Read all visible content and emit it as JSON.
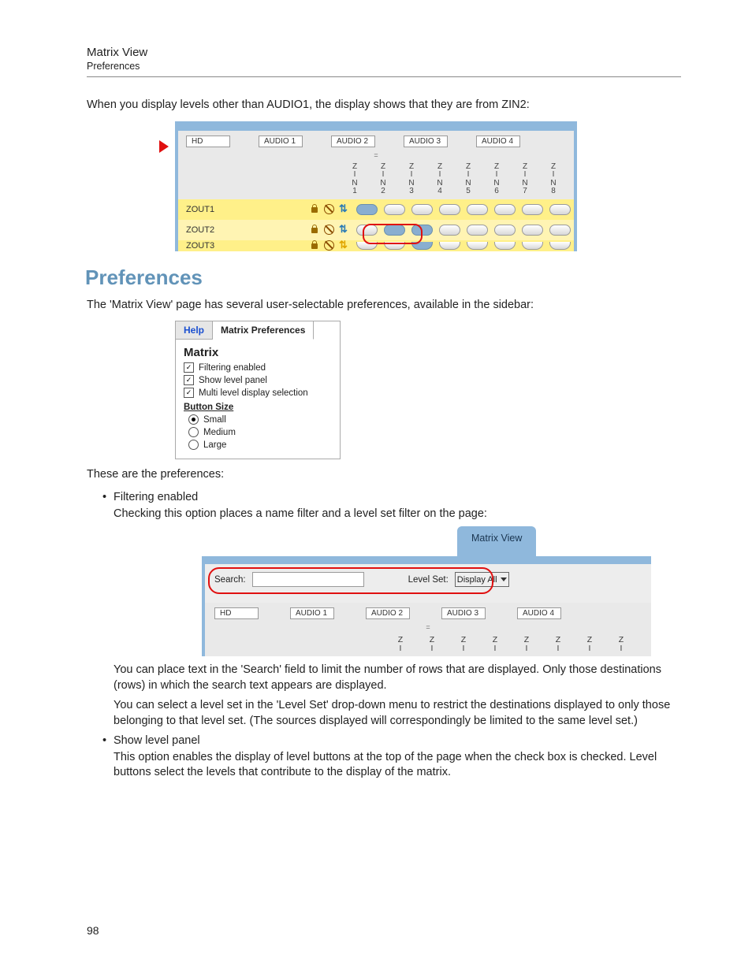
{
  "header": {
    "title": "Matrix View",
    "sub": "Preferences"
  },
  "intro": "When you display levels other than AUDIO1, the display shows that they are from ZIN2:",
  "fig1": {
    "levels": [
      "HD",
      "AUDIO 1",
      "AUDIO 2",
      "AUDIO 3",
      "AUDIO 4"
    ],
    "col_label_top": "Z",
    "col_label_mid": "I",
    "col_label_bot": "N",
    "col_nums": [
      "1",
      "2",
      "3",
      "4",
      "5",
      "6",
      "7",
      "8"
    ],
    "rows": [
      {
        "name": "ZOUT1",
        "icons": [
          "lock",
          "nosign",
          "switch-blue"
        ],
        "states": [
          1,
          0,
          0,
          0,
          0,
          0,
          0,
          0
        ]
      },
      {
        "name": "ZOUT2",
        "icons": [
          "lock",
          "nosign",
          "switch-blue"
        ],
        "states": [
          0,
          1,
          1,
          0,
          0,
          0,
          0,
          0
        ]
      },
      {
        "name": "ZOUT3",
        "icons": [
          "lock",
          "nosign",
          "switch"
        ],
        "states": [
          0,
          0,
          1,
          0,
          0,
          0,
          0,
          0
        ],
        "cut": true
      }
    ]
  },
  "section_heading": "Preferences",
  "pref_intro": "The 'Matrix View' page has several user-selectable preferences, available in the sidebar:",
  "fig2": {
    "tab_help": "Help",
    "tab_active": "Matrix Preferences",
    "heading": "Matrix",
    "checks": [
      {
        "label": "Filtering enabled",
        "checked": true
      },
      {
        "label": "Show level panel",
        "checked": true
      },
      {
        "label": "Multi level display selection",
        "checked": true
      }
    ],
    "size_heading": "Button Size",
    "radios": [
      {
        "label": "Small",
        "sel": true
      },
      {
        "label": "Medium",
        "sel": false
      },
      {
        "label": "Large",
        "sel": false
      }
    ]
  },
  "pref_lead": "These are the preferences:",
  "bullet1": "Filtering enabled",
  "bullet1_sub": "Checking this option places a name filter and a level set filter on the page:",
  "fig3": {
    "tab": "Matrix View",
    "search_label": "Search:",
    "levelset_label": "Level Set:",
    "levelset_value": "Display All",
    "levels": [
      "HD",
      "AUDIO 1",
      "AUDIO 2",
      "AUDIO 3",
      "AUDIO 4"
    ],
    "z_top": "Z",
    "z_bot": "I",
    "col_count": 8
  },
  "p_search": "You can place text in the 'Search' field to limit the number of rows that are displayed. Only those destinations (rows) in which the search text appears are displayed.",
  "p_levelset": "You can select a level set in the 'Level Set' drop-down menu to restrict the destinations displayed to only those belonging to that level set. (The sources displayed will correspondingly be limited to the same level set.)",
  "bullet2": "Show level panel",
  "bullet2_sub": "This option enables the display of level buttons at the top of the page when the check box is checked. Level buttons select the levels that contribute to the display of the matrix.",
  "page_number": "98"
}
